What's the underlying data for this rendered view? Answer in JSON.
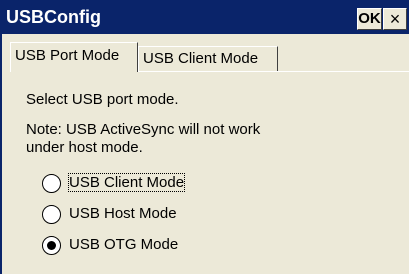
{
  "window": {
    "title": "USBConfig",
    "ok_label": "OK",
    "close_label": "×"
  },
  "tabs": [
    {
      "label": "USB Port Mode",
      "active": true
    },
    {
      "label": "USB Client Mode",
      "active": false
    }
  ],
  "content": {
    "instruction": "Select USB port mode.",
    "note_line1": "Note: USB ActiveSync will not work",
    "note_line2": "under host mode."
  },
  "radio_options": [
    {
      "label": "USB Client Mode",
      "selected": false,
      "focused": true
    },
    {
      "label": "USB Host Mode",
      "selected": false,
      "focused": false
    },
    {
      "label": "USB OTG Mode",
      "selected": true,
      "focused": false
    }
  ],
  "colors": {
    "titlebar": "#0a246a",
    "window_bg": "#ece9d8"
  }
}
